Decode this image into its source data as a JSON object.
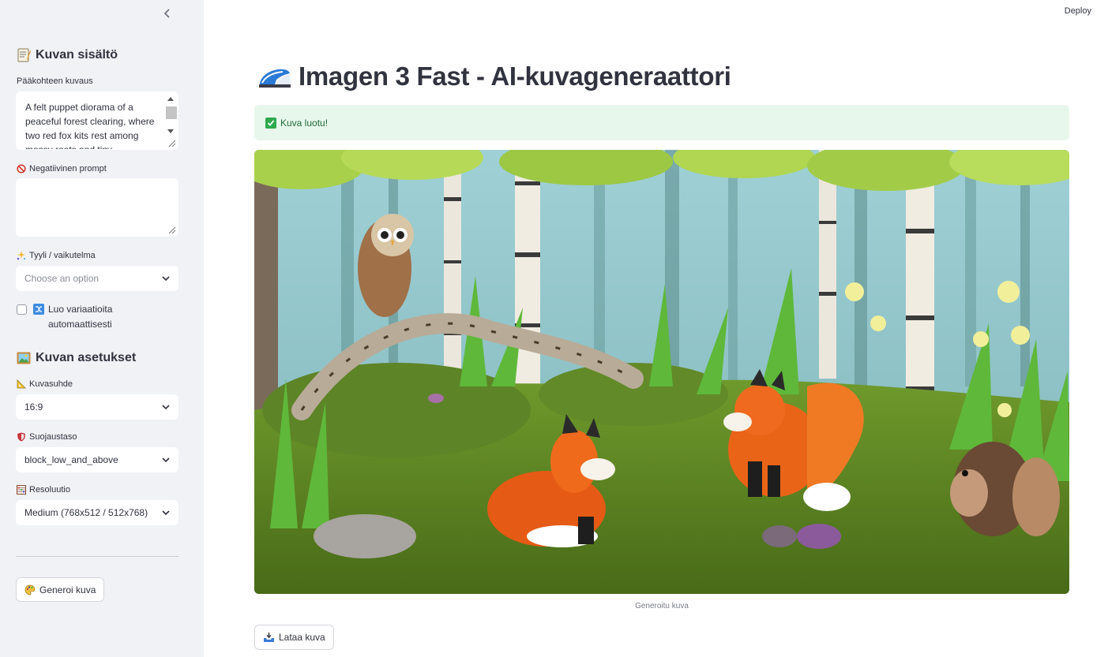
{
  "header": {
    "deploy_label": "Deploy"
  },
  "sidebar": {
    "section_content_title": "Kuvan sisältö",
    "main_subject_label": "Pääkohteen kuvaus",
    "main_subject_value": "A felt puppet diorama of a peaceful forest clearing, where two red fox kits rest among mossy roots and tiny",
    "negative_prompt_label": "Negatiivinen prompt",
    "negative_prompt_value": "",
    "style_label": "Tyyli / vaikutelma",
    "style_placeholder": "Choose an option",
    "variations_label": "Luo variaatioita automaattisesti",
    "section_settings_title": "Kuvan asetukset",
    "aspect_label": "Kuvasuhde",
    "aspect_value": "16:9",
    "safety_label": "Suojaustaso",
    "safety_value": "block_low_and_above",
    "resolution_label": "Resoluutio",
    "resolution_value": "Medium (768x512 / 512x768)",
    "generate_label": "Generoi kuva"
  },
  "main": {
    "title": "Imagen 3 Fast - AI-kuvageneraattori",
    "success_message": "Kuva luotu!",
    "image_caption": "Generoitu kuva",
    "download_label": "Lataa kuva"
  },
  "colors": {
    "sidebar_bg": "#f0f2f6",
    "text": "#31333f",
    "success_bg": "#e8f7ec",
    "success_text": "#1e6b3a"
  },
  "icons": {
    "section_content": "memo-icon",
    "negative": "prohibited-icon",
    "style": "sparkles-icon",
    "variations": "shuffle-icon",
    "section_settings": "framed-picture-icon",
    "aspect": "triangular-ruler-icon",
    "safety": "shield-icon",
    "resolution": "abacus-icon",
    "generate": "palette-icon",
    "title": "shoe-icon",
    "success": "check-mark-icon",
    "download": "inbox-tray-icon"
  }
}
